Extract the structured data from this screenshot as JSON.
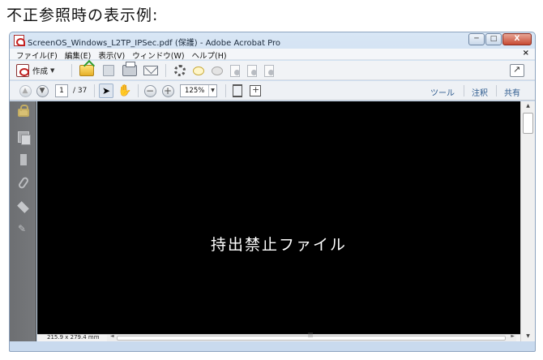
{
  "caption": "不正参照時の表示例:",
  "window": {
    "title": "ScreenOS_Windows_L2TP_IPSec.pdf (保護) - Adobe Acrobat Pro",
    "minimize_glyph": "─",
    "maximize_glyph": "□",
    "close_glyph": "X"
  },
  "menu": {
    "items": [
      "ファイル(F)",
      "編集(E)",
      "表示(V)",
      "ウィンドウ(W)",
      "ヘルプ(H)"
    ],
    "close_glyph": "×"
  },
  "toolbar1": {
    "create_label": "作成",
    "icons": [
      "create-pdf-icon",
      "open-folder-icon",
      "save-icon",
      "print-icon",
      "email-icon",
      "settings-icon",
      "comment-icon",
      "highlight-comment-icon",
      "document-action-icon",
      "document-export-icon",
      "document-review-icon",
      "expand-icon"
    ]
  },
  "toolbar2": {
    "current_page": "1",
    "total_pages": "/ 37",
    "zoom": "125%",
    "right_links": [
      "ツール",
      "注釈",
      "共有"
    ]
  },
  "left_nav": [
    "lock-icon",
    "pages-icon",
    "bookmark-icon",
    "attachment-icon",
    "layers-icon",
    "signature-icon"
  ],
  "document": {
    "message": "持出禁止ファイル",
    "page_size": "215.9 x 279.4 mm"
  },
  "colors": {
    "document_background": "#000000",
    "message_text": "#ffffff",
    "link_text": "#2e5b8f",
    "window_chrome": "#c9daee"
  }
}
